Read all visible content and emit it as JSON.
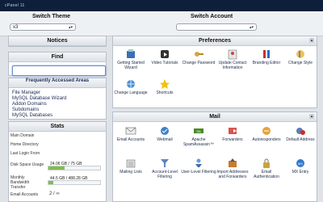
{
  "brand": "cPanel 11",
  "switch_theme": {
    "label": "Switch Theme",
    "value": "x3"
  },
  "switch_account": {
    "label": "Switch Account",
    "value": ""
  },
  "notices": {
    "title": "Notices"
  },
  "find": {
    "title": "Find",
    "placeholder": ""
  },
  "frequent": {
    "title": "Frequently Accessed Areas",
    "items": [
      "File Manager",
      "MySQL Database Wizard",
      "Addon Domains",
      "Subdomains",
      "MySQL Databases"
    ]
  },
  "stats": {
    "title": "Stats",
    "rows": [
      {
        "label": "Main Domain",
        "value": ""
      },
      {
        "label": "Home Directory",
        "value": ""
      },
      {
        "label": "Last Login From",
        "value": ""
      },
      {
        "label": "Disk Space Usage",
        "value": "24.06 GB / 75 GB",
        "fraction": 0.32
      },
      {
        "label": "Monthly Bandwidth Transfer",
        "value": "44.5 GB / 488.28 GB",
        "fraction": 0.09
      },
      {
        "label": "Email Accounts",
        "value": "2 / ∞"
      }
    ]
  },
  "preferences": {
    "title": "Preferences",
    "tiles": [
      {
        "label": "Getting Started Wizard",
        "icon": "wizard-icon"
      },
      {
        "label": "Video Tutorials",
        "icon": "video-icon"
      },
      {
        "label": "Change Password",
        "icon": "key-icon"
      },
      {
        "label": "Update Contact Information",
        "icon": "contact-icon"
      },
      {
        "label": "Branding Editor",
        "icon": "branding-icon"
      },
      {
        "label": "Change Style",
        "icon": "style-icon"
      },
      {
        "label": "Change Language",
        "icon": "language-icon"
      },
      {
        "label": "Shortcuts",
        "icon": "star-icon"
      }
    ]
  },
  "mail": {
    "title": "Mail",
    "tiles": [
      {
        "label": "Email Accounts",
        "icon": "envelope-icon"
      },
      {
        "label": "Webmail",
        "icon": "webmail-icon"
      },
      {
        "label": "Apache SpamAssassin™",
        "icon": "spamassassin-icon"
      },
      {
        "label": "Forwarders",
        "icon": "forwarder-icon"
      },
      {
        "label": "Autoresponders",
        "icon": "autoresponder-icon"
      },
      {
        "label": "Default Address",
        "icon": "default-address-icon"
      },
      {
        "label": "Mailing Lists",
        "icon": "mailing-list-icon"
      },
      {
        "label": "Account-Level Filtering",
        "icon": "filter-icon"
      },
      {
        "label": "User-Level Filtering",
        "icon": "user-filter-icon"
      },
      {
        "label": "Import Addresses and Forwarders",
        "icon": "import-icon"
      },
      {
        "label": "Email Authentication",
        "icon": "auth-icon"
      },
      {
        "label": "MX Entry",
        "icon": "mx-icon"
      }
    ]
  }
}
